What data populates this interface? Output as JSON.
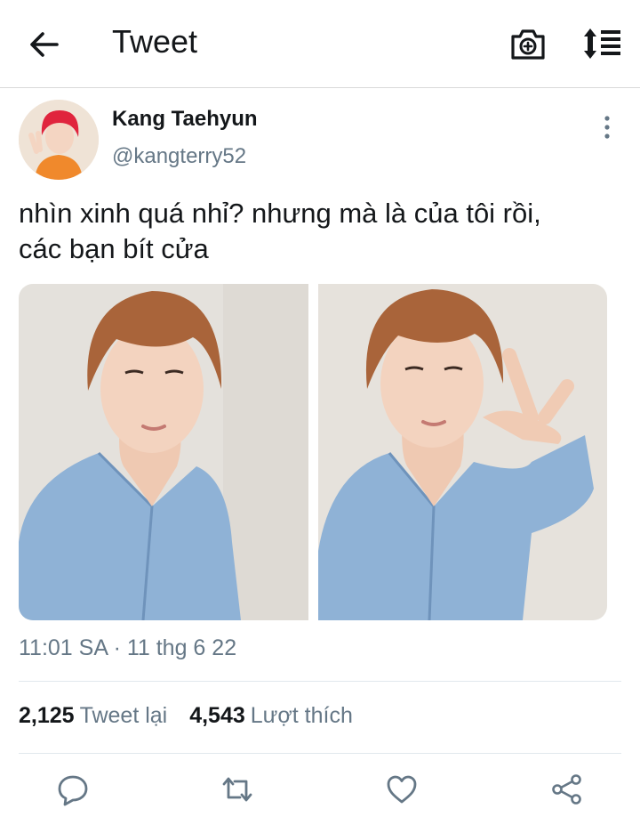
{
  "header": {
    "title": "Tweet",
    "back_icon": "arrow-left-icon",
    "camera_icon": "camera-plus-icon",
    "sort_icon": "sort-list-icon"
  },
  "tweet": {
    "author": {
      "name": "Kang Taehyun",
      "handle": "@kangterry52",
      "avatar_hair_color": "#e0243d"
    },
    "text_lines": [
      "nhìn xinh quá nhỉ? nhưng mà là của tôi rồi,",
      "các bạn bít cửa"
    ],
    "timestamp": "11:01 SA · 11 thg 6 22",
    "stats": {
      "retweets": {
        "count": "2,125",
        "label": "Tweet lại"
      },
      "likes": {
        "count": "4,543",
        "label": "Lượt thích"
      }
    },
    "media": [
      {
        "description": "selfie-shirt",
        "shirt_color": "#8fb2d6",
        "hair_color": "#a9643a"
      },
      {
        "description": "selfie-peace-sign",
        "shirt_color": "#8fb2d6",
        "hair_color": "#a9643a"
      }
    ]
  },
  "actions": [
    "reply-icon",
    "retweet-icon",
    "like-icon",
    "share-icon"
  ],
  "colors": {
    "text": "#14171a",
    "secondary": "#657786",
    "divider": "#e1e8ed"
  }
}
